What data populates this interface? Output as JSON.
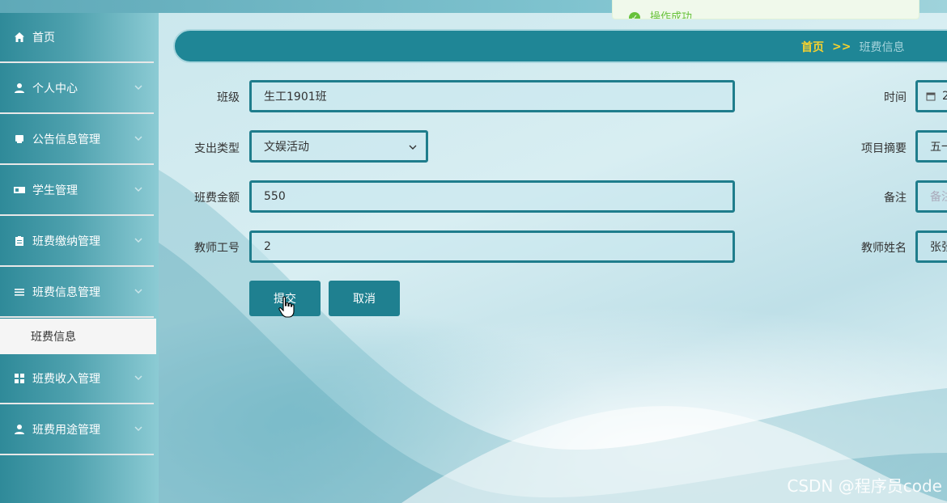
{
  "toast": {
    "message": "操作成功"
  },
  "breadcrumb": {
    "home": "首页",
    "separator": ">>",
    "current": "班费信息"
  },
  "sidebar": {
    "items": [
      {
        "label": "首页",
        "icon": "home-icon"
      },
      {
        "label": "个人中心",
        "icon": "user-icon"
      },
      {
        "label": "公告信息管理",
        "icon": "notice-icon"
      },
      {
        "label": "学生管理",
        "icon": "id-card-icon"
      },
      {
        "label": "班费缴纳管理",
        "icon": "clipboard-icon"
      },
      {
        "label": "班费信息管理",
        "icon": "list-icon"
      },
      {
        "label": "班费收入管理",
        "icon": "grid-icon"
      },
      {
        "label": "班费用途管理",
        "icon": "user-icon"
      }
    ],
    "active_submenu": "班费信息"
  },
  "form": {
    "class_label": "班级",
    "class_value": "生工1901班",
    "time_label": "时间",
    "time_value": "2",
    "expense_type_label": "支出类型",
    "expense_type_value": "文娱活动",
    "project_summary_label": "项目摘要",
    "project_summary_value": "五一",
    "amount_label": "班费金额",
    "amount_value": "550",
    "remark_label": "备注",
    "remark_placeholder": "备注",
    "teacher_id_label": "教师工号",
    "teacher_id_value": "2",
    "teacher_name_label": "教师姓名",
    "teacher_name_value": "张张",
    "submit_label": "提交",
    "cancel_label": "取消"
  },
  "watermark": "CSDN @程序员code"
}
